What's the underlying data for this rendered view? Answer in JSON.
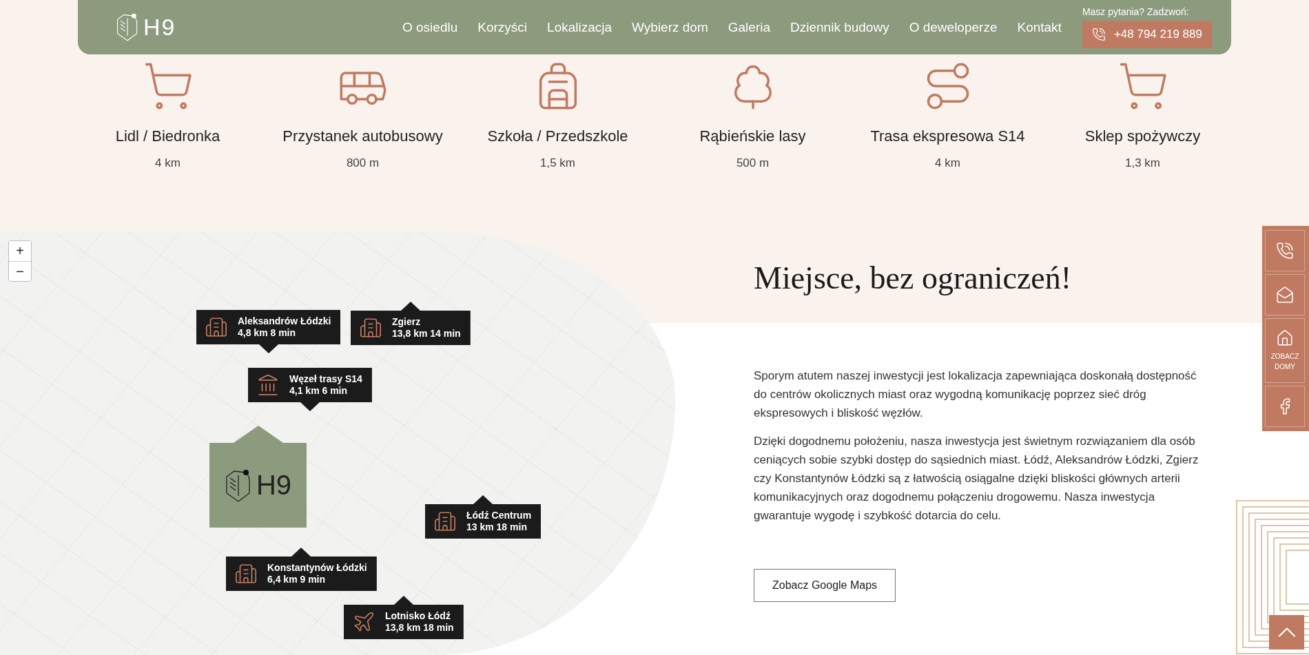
{
  "header": {
    "logo_text": "H9",
    "nav": [
      "O osiedlu",
      "Korzyści",
      "Lokalizacja",
      "Wybierz dom",
      "Galeria",
      "Dziennik budowy",
      "O deweloperze",
      "Kontakt"
    ],
    "contact_prompt": "Masz pytania? Zadzwoń:",
    "phone": "+48 794 219 889"
  },
  "amenities": [
    {
      "kind": "cart",
      "title": "Lidl / Biedronka",
      "distance": "4 km"
    },
    {
      "kind": "bus",
      "title": "Przystanek autobusowy",
      "distance": "800 m"
    },
    {
      "kind": "backpack",
      "title": "Szkoła / Przedszkole",
      "distance": "1,5 km"
    },
    {
      "kind": "trees",
      "title": "Rąbieńskie lasy",
      "distance": "500 m"
    },
    {
      "kind": "road",
      "title": "Trasa ekspresowa S14",
      "distance": "4 km"
    },
    {
      "kind": "cart",
      "title": "Sklep spożywczy",
      "distance": "1,3 km"
    }
  ],
  "map": {
    "zoom_in": "+",
    "zoom_out": "−",
    "logo_marker": "H9",
    "markers": [
      {
        "kind": "city",
        "title": "Aleksandrów Łódzki",
        "detail": "4,8 km 8 min"
      },
      {
        "kind": "city",
        "title": "Zgierz",
        "detail": "13,8 km 14 min"
      },
      {
        "kind": "junction",
        "title": "Węzeł trasy S14",
        "detail": "4,1 km 6 min"
      },
      {
        "kind": "city",
        "title": "Łódź Centrum",
        "detail": "13 km 18 min"
      },
      {
        "kind": "city",
        "title": "Konstantynów Łódzki",
        "detail": "6,4 km 9 min"
      },
      {
        "kind": "airport",
        "title": "Lotnisko Łódź",
        "detail": "13,8 km 18 min"
      }
    ]
  },
  "section": {
    "heading": "Miejsce, bez ograniczeń!",
    "paragraphs": [
      "Sporym atutem naszej inwestycji jest lokalizacja zapewniająca doskonałą dostępność do centrów okolicznych miast oraz wygodną komunikację poprzez sieć dróg ekspresowych i bliskość węzłów.",
      "Dzięki dogodnemu położeniu, nasza inwestycja jest świetnym rozwiązaniem dla osób ceniących sobie szybki dostęp do sąsiednich miast. Łódź, Aleksandrów Łódzki, Zgierz czy Konstantynów Łódzki są z łatwością osiągalne dzięki bliskości głównych arterii komunikacyjnych oraz dogodnemu połączeniu drogowemu. Nasza inwestycja gwarantuje wygodę i szybkość dotarcia do celu."
    ],
    "button": "Zobacz Google Maps"
  },
  "side_panel": [
    {
      "kind": "phone"
    },
    {
      "kind": "mail"
    },
    {
      "kind": "home",
      "label": "ZOBACZ DOMY"
    },
    {
      "kind": "facebook"
    }
  ]
}
